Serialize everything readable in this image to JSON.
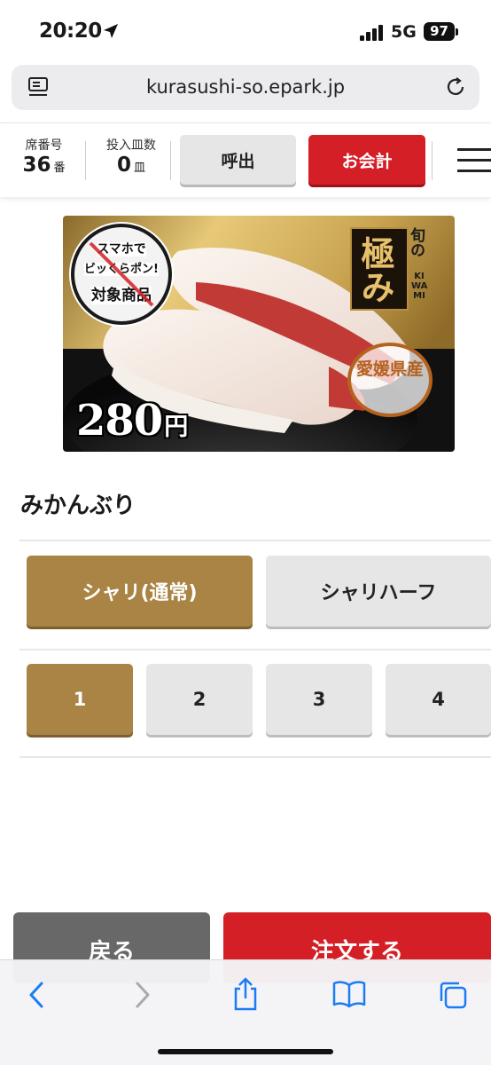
{
  "status_bar": {
    "time": "20:20",
    "network": "5G",
    "battery": "97"
  },
  "browser": {
    "url": "kurasushi-so.epark.jp"
  },
  "header": {
    "seat_label": "席番号",
    "seat_number": "36",
    "seat_unit": "番",
    "plates_label": "投入皿数",
    "plates_count": "0",
    "plates_unit": "皿",
    "call_button": "呼出",
    "checkout_button": "お会計"
  },
  "product": {
    "promo_line1": "スマホで",
    "promo_line2": "ビッくらポン!",
    "promo_line3": "対象商品",
    "price": "280",
    "price_unit": "円",
    "badge_main": "極み",
    "badge_side": "旬の",
    "badge_roman": "KI WA MI",
    "origin_stamp": "愛媛県産",
    "name": "みかんぶり"
  },
  "rice_options": [
    {
      "label": "シャリ(通常)",
      "selected": true
    },
    {
      "label": "シャリハーフ",
      "selected": false
    }
  ],
  "quantity_options": [
    {
      "label": "1",
      "selected": true
    },
    {
      "label": "2",
      "selected": false
    },
    {
      "label": "3",
      "selected": false
    },
    {
      "label": "4",
      "selected": false
    }
  ],
  "footer": {
    "back_button": "戻る",
    "order_button": "注文する"
  },
  "colors": {
    "accent_red": "#d51f27",
    "selected_gold": "#a98444",
    "unselected_gray": "#e6e6e6",
    "ios_blue": "#1a7cf5"
  }
}
